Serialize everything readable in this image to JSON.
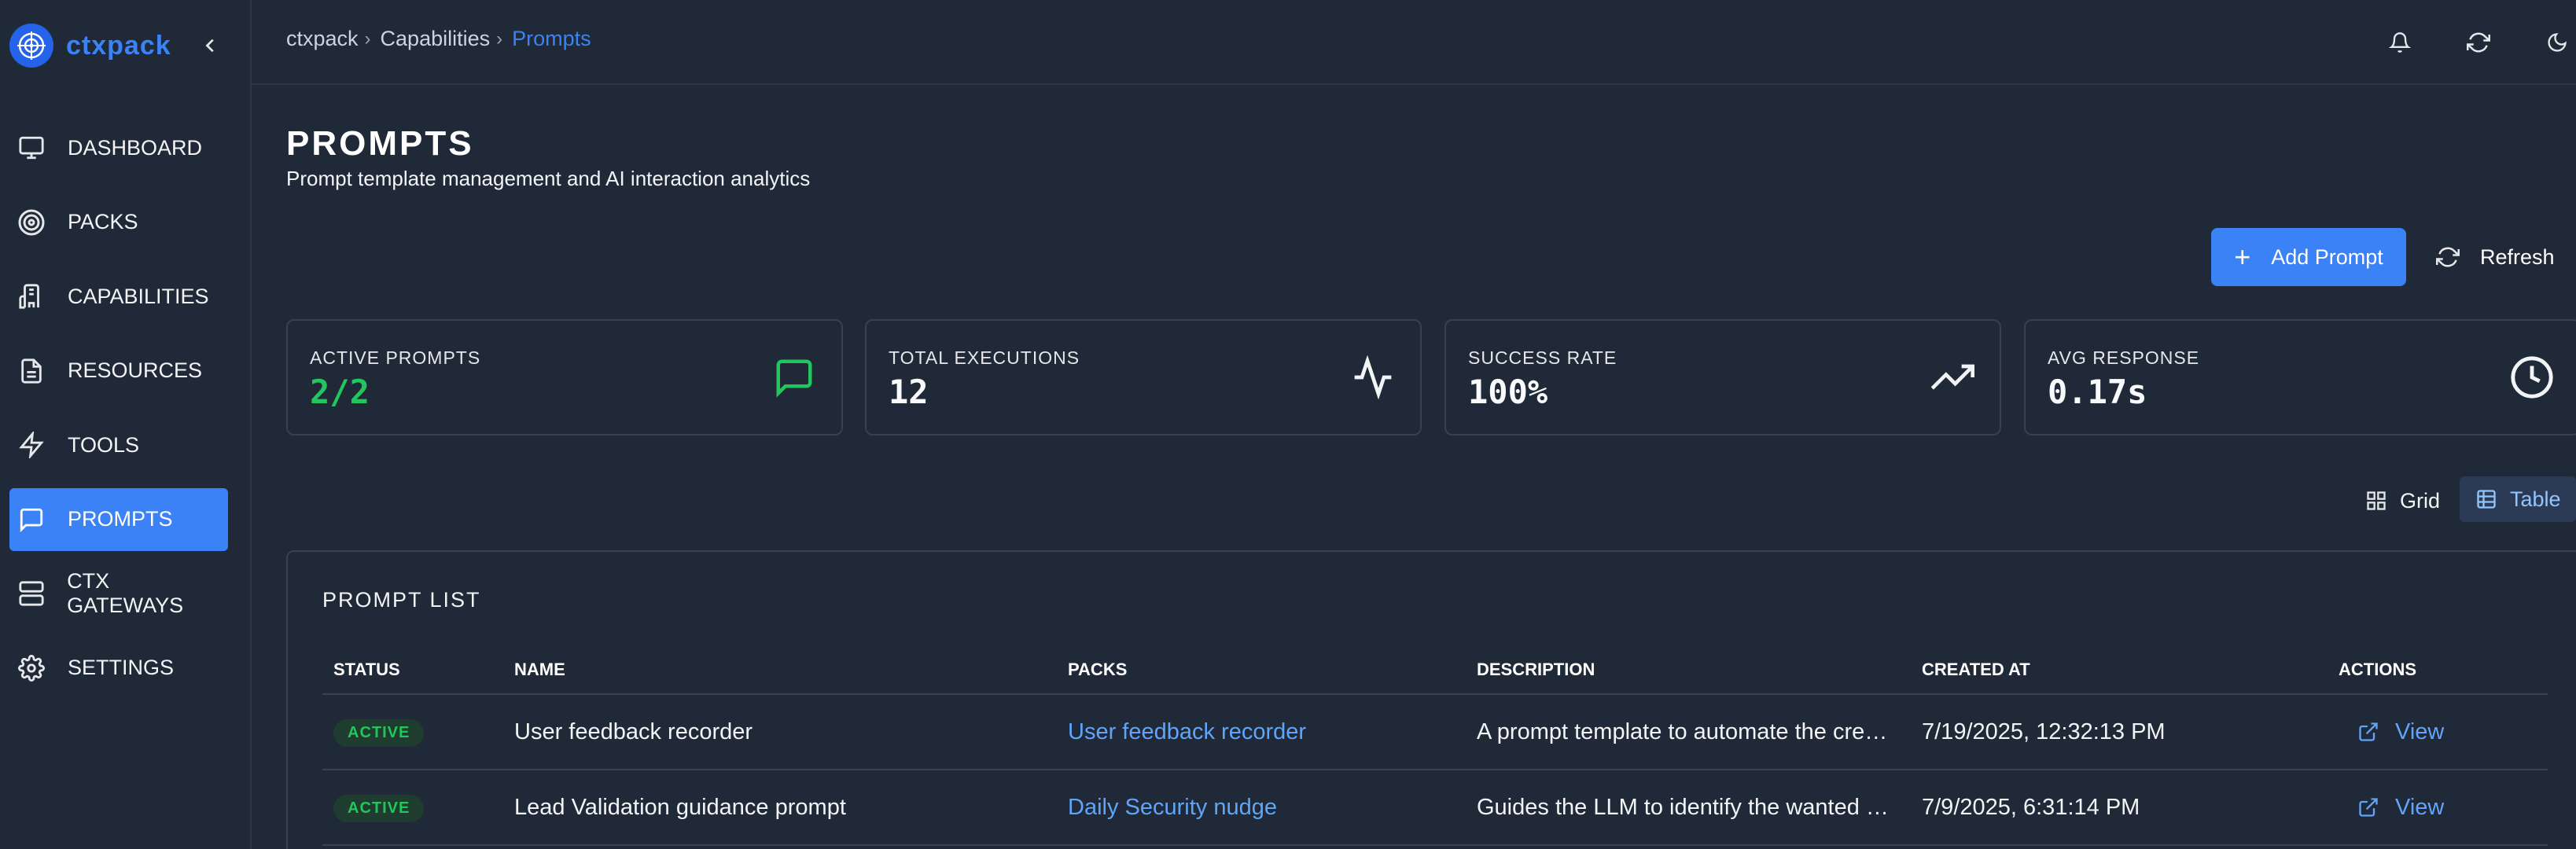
{
  "app": {
    "name": "ctxpack"
  },
  "sidebar": {
    "items": [
      {
        "label": "DASHBOARD",
        "icon": "monitor-icon",
        "active": false
      },
      {
        "label": "PACKS",
        "icon": "target-icon",
        "active": false
      },
      {
        "label": "CAPABILITIES",
        "icon": "building-icon",
        "active": false
      },
      {
        "label": "RESOURCES",
        "icon": "file-text-icon",
        "active": false
      },
      {
        "label": "TOOLS",
        "icon": "bolt-icon",
        "active": false
      },
      {
        "label": "PROMPTS",
        "icon": "message-icon",
        "active": true
      },
      {
        "label": "CTX GATEWAYS",
        "icon": "server-icon",
        "active": false
      },
      {
        "label": "SETTINGS",
        "icon": "gear-icon",
        "active": false
      }
    ]
  },
  "breadcrumb": [
    "ctxpack",
    "Capabilities",
    "Prompts"
  ],
  "page": {
    "title": "PROMPTS",
    "subtitle": "Prompt template management and AI interaction analytics"
  },
  "actions": {
    "add_label": "Add Prompt",
    "refresh_label": "Refresh"
  },
  "stats": [
    {
      "label": "ACTIVE PROMPTS",
      "value": "2/2",
      "icon": "message-icon"
    },
    {
      "label": "TOTAL EXECUTIONS",
      "value": "12",
      "icon": "activity-icon"
    },
    {
      "label": "SUCCESS RATE",
      "value": "100%",
      "icon": "trending-up-icon"
    },
    {
      "label": "AVG RESPONSE",
      "value": "0.17s",
      "icon": "clock-icon"
    }
  ],
  "view_toggle": {
    "grid_label": "Grid",
    "table_label": "Table",
    "selected": "Table"
  },
  "prompt_list": {
    "title": "PROMPT LIST",
    "columns": [
      "STATUS",
      "NAME",
      "PACKS",
      "DESCRIPTION",
      "CREATED AT",
      "ACTIONS"
    ],
    "rows": [
      {
        "status": "ACTIVE",
        "name": "User feedback recorder",
        "packs": "User feedback recorder",
        "description": "A prompt template to automate the cre…",
        "created_at": "7/19/2025, 12:32:13 PM",
        "action": "View"
      },
      {
        "status": "ACTIVE",
        "name": "Lead Validation guidance prompt",
        "packs": "Daily Security nudge",
        "description": "Guides the LLM to identify the wanted …",
        "created_at": "7/9/2025, 6:31:14 PM",
        "action": "View"
      }
    ]
  },
  "colors": {
    "background": "#1f2937",
    "accent": "#3b82f6",
    "success": "#22c55e",
    "link": "#60a5fa"
  }
}
